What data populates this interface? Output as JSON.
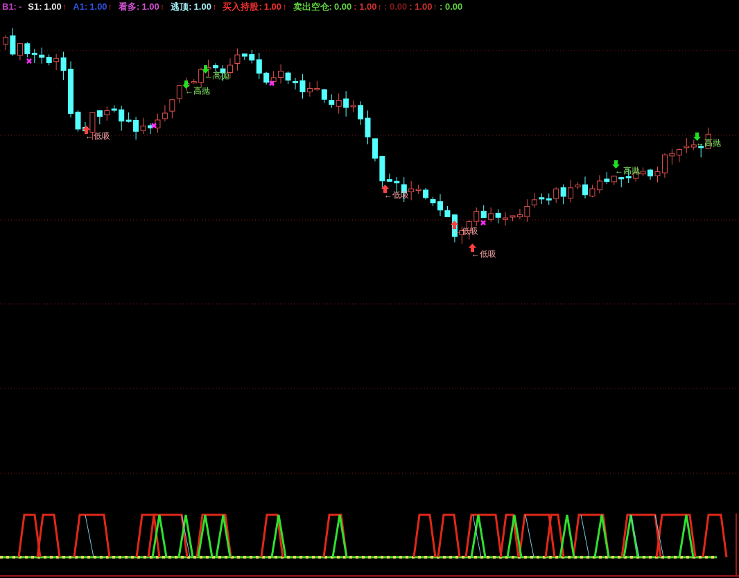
{
  "legend": [
    {
      "label": "B1:",
      "color": "#c040c0",
      "segments": [
        {
          "text": "-"
        }
      ]
    },
    {
      "label": "S1:",
      "color": "#e0e0e0",
      "segments": [
        {
          "text": "1.00",
          "color": "#e0e0e0",
          "arrow": "↑"
        }
      ]
    },
    {
      "label": "A1:",
      "color": "#3050e0",
      "segments": [
        {
          "text": "1.00",
          "color": "#3050e0",
          "arrow": "↑"
        }
      ]
    },
    {
      "label": "看多:",
      "color": "#d050d0",
      "segments": [
        {
          "text": "1.00",
          "color": "#d050d0",
          "arrow": "↑"
        }
      ]
    },
    {
      "label": "逃顶:",
      "color": "#a0e8f0",
      "segments": [
        {
          "text": "1.00",
          "color": "#a0e8f0",
          "arrow": "↑"
        }
      ]
    },
    {
      "label": "买入持股:",
      "color": "#f03030",
      "segments": [
        {
          "text": "1.00",
          "color": "#f03030",
          "arrow": "↑"
        }
      ]
    },
    {
      "label": "卖出空仓:",
      "color": "#60d040",
      "segments": [
        {
          "text": "0.00",
          "color": "#60d040"
        },
        {
          "text": ": 1.00",
          "color": "#d03030",
          "arrow": "↑"
        },
        {
          "text": ": 0.00",
          "color": "#801818"
        },
        {
          "text": ": 1.00",
          "color": "#d03030",
          "arrow": "↑"
        },
        {
          "text": ": 0.00",
          "color": "#60d040"
        }
      ]
    }
  ],
  "signals": [
    {
      "kind": "buy",
      "text": "←低吸"
    },
    {
      "kind": "sell",
      "text": "←高抛"
    },
    {
      "kind": "sell",
      "text": "←高抛"
    },
    {
      "kind": "buy",
      "text": "←低吸"
    },
    {
      "kind": "buy",
      "text": "←低吸"
    },
    {
      "kind": "buy",
      "text": "←低吸"
    },
    {
      "kind": "sell",
      "text": "←高抛"
    },
    {
      "kind": "sell",
      "text": "←高抛"
    }
  ]
}
